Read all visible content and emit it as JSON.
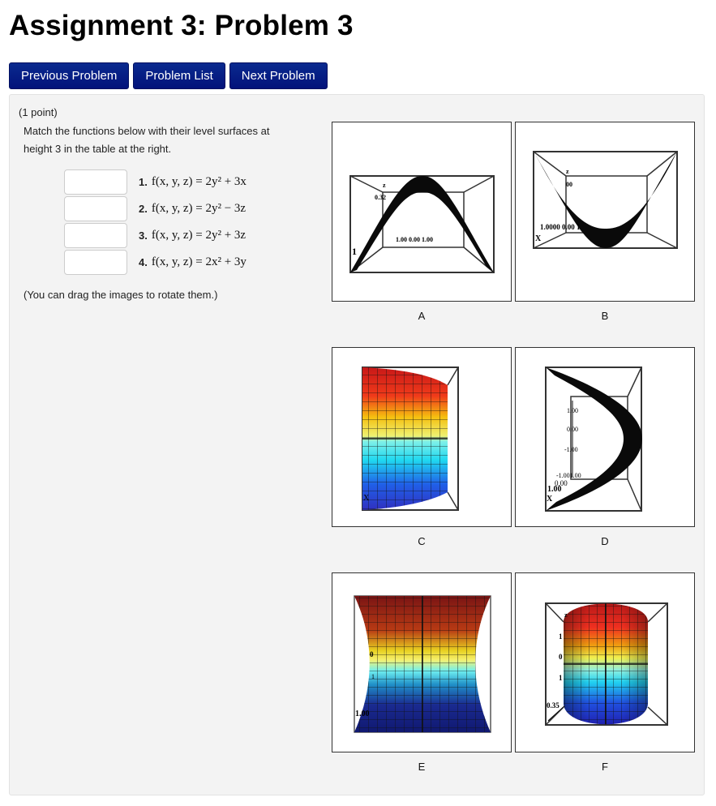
{
  "page": {
    "title": "Assignment 3: Problem 3"
  },
  "nav": {
    "previous": "Previous Problem",
    "list": "Problem List",
    "next": "Next Problem"
  },
  "problem": {
    "points": "(1 point)",
    "instructions": "Match the functions below with their level surfaces at height 3 in the table at the right.",
    "drag_note": "(You can drag the images to rotate them.)",
    "items": [
      {
        "num": "1.",
        "lhs": "f(x, y, z) = 2y² + 3x",
        "value": ""
      },
      {
        "num": "2.",
        "lhs": "f(x, y, z) = 2y² − 3z",
        "value": ""
      },
      {
        "num": "3.",
        "lhs": "f(x, y, z) = 2y² + 3z",
        "value": ""
      },
      {
        "num": "4.",
        "lhs": "f(x, y, z) = 2x² + 3y",
        "value": ""
      }
    ]
  },
  "images": [
    {
      "label": "A",
      "kind": "black-parabolic-sheet-cap",
      "tick_text": [
        "z",
        "0.32",
        "1.00 0.00 1.00",
        "1"
      ]
    },
    {
      "label": "B",
      "kind": "black-parabolic-sheet-cup",
      "tick_text": [
        "z",
        "00",
        "1.0000 0.00 1",
        "X"
      ]
    },
    {
      "label": "C",
      "kind": "colored-cylindrical-sheet",
      "tick_text": [
        "X"
      ]
    },
    {
      "label": "D",
      "kind": "black-parabolic-sheet-side",
      "tick_text": [
        "1.00",
        "0.00",
        "-1.00",
        "-1.001.00",
        "0.00",
        "1.00",
        "X"
      ]
    },
    {
      "label": "E",
      "kind": "colored-hyperboloid",
      "tick_text": [
        "0",
        "1",
        "1.00"
      ]
    },
    {
      "label": "F",
      "kind": "colored-ellipsoid",
      "tick_text": [
        "z",
        "1",
        "0",
        "1",
        "0.35"
      ]
    }
  ]
}
